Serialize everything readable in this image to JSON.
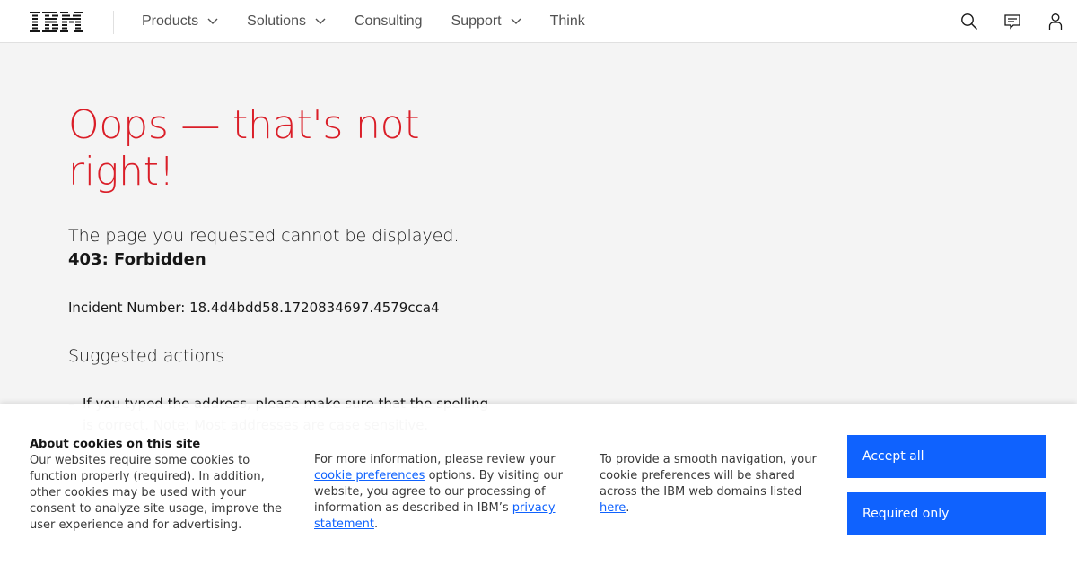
{
  "header": {
    "logo_alt": "IBM",
    "nav": [
      {
        "label": "Products",
        "has_dropdown": true
      },
      {
        "label": "Solutions",
        "has_dropdown": true
      },
      {
        "label": "Consulting",
        "has_dropdown": false
      },
      {
        "label": "Support",
        "has_dropdown": true
      },
      {
        "label": "Think",
        "has_dropdown": false
      }
    ],
    "actions": [
      {
        "name": "search",
        "icon": "search-icon"
      },
      {
        "name": "contact",
        "icon": "chat-icon"
      },
      {
        "name": "profile",
        "icon": "user-icon"
      }
    ]
  },
  "main": {
    "title": "Oops — that's not right!",
    "lead": "The page you requested cannot be displayed.",
    "error_code": "403: Forbidden",
    "incident": "Incident Number: 18.4d4bdd58.1720834697.4579cca4",
    "suggested_heading": "Suggested actions",
    "suggestions": [
      "If you typed the address, please make sure that the spelling is correct. Note: Most addresses are case sensitive."
    ]
  },
  "cookie": {
    "heading": "About cookies on this site",
    "col1_text": "Our websites require some cookies to function properly (required). In addition, other cookies may be used with your consent to analyze site usage, improve the user experience and for advertising.",
    "col2_pre": "For more information, please review your ",
    "col2_link1": "cookie preferences",
    "col2_mid": " options. By visiting our website, you agree to our processing of information as described in IBM’s ",
    "col2_link2": "privacy statement",
    "col2_post": ".",
    "col3_pre": "To provide a smooth navigation, your cookie preferences will be shared across the IBM web domains listed ",
    "col3_link": "here",
    "col3_post": ".",
    "accept_label": "Accept all",
    "required_label": "Required only"
  },
  "colors": {
    "accent": "#0f62fe",
    "error_title": "#da1e28",
    "background": "#f4f4f4"
  }
}
